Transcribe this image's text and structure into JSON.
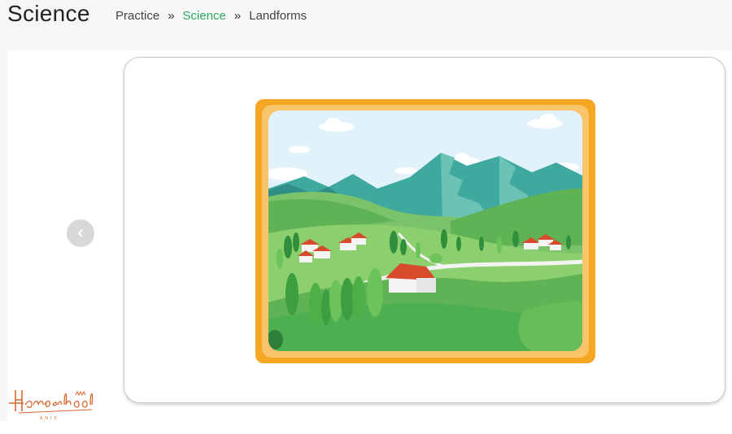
{
  "header": {
    "title": "Science",
    "breadcrumb": [
      {
        "label": "Practice"
      },
      {
        "label": "Science"
      },
      {
        "label": "Landforms"
      }
    ],
    "separator": "»"
  },
  "carousel": {
    "prev_icon": "chevron-left-icon",
    "image_icon": "landscape-illustration"
  },
  "logo": {
    "text": "Homeschool",
    "subtext": "ANIS"
  },
  "colors": {
    "accent": "#2ea866",
    "frame": "#f5a623",
    "sky": "#e3f3fb",
    "mountain": "#3fa9a0",
    "grass": "#4caf50"
  }
}
